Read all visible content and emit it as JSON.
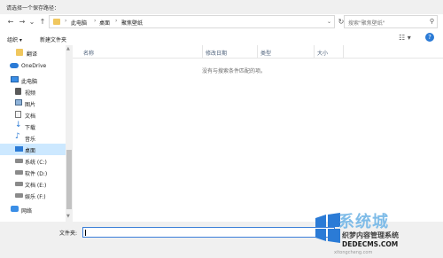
{
  "window": {
    "title": "请选择一个保存路径："
  },
  "nav": {
    "back_icon": "left-arrow-icon",
    "forward_icon": "right-arrow-icon",
    "up_icon": "up-arrow-icon",
    "breadcrumbs": [
      "此电脑",
      "桌面",
      "聚焦壁纸"
    ],
    "search_placeholder": "搜索\"聚焦壁纸\""
  },
  "toolbar": {
    "organize_label": "组织 ▾",
    "new_folder_label": "新建文件夹"
  },
  "sidebar": {
    "items": [
      {
        "label": "翻译",
        "icon": "folder-icon"
      },
      {
        "label": "OneDrive",
        "icon": "cloud-icon"
      },
      {
        "label": "此电脑",
        "icon": "computer-icon"
      },
      {
        "label": "视频",
        "icon": "video-icon"
      },
      {
        "label": "图片",
        "icon": "picture-icon"
      },
      {
        "label": "文档",
        "icon": "document-icon"
      },
      {
        "label": "下载",
        "icon": "download-icon"
      },
      {
        "label": "音乐",
        "icon": "music-icon"
      },
      {
        "label": "桌面",
        "icon": "desktop-icon",
        "selected": true
      },
      {
        "label": "系统 (C:)",
        "icon": "drive-icon"
      },
      {
        "label": "软件 (D:)",
        "icon": "drive-icon"
      },
      {
        "label": "文档 (E:)",
        "icon": "drive-icon"
      },
      {
        "label": "娱乐 (F:)",
        "icon": "drive-icon"
      },
      {
        "label": "网络",
        "icon": "network-icon"
      }
    ]
  },
  "columns": [
    "名称",
    "修改日期",
    "类型",
    "大小"
  ],
  "empty_message": "没有与搜索条件匹配的项。",
  "footer": {
    "filename_label": "文件夹:",
    "filename_value": ""
  },
  "watermark": {
    "big": "系统城",
    "cn": "织梦内容管理系统",
    "url": "DEDECMS.COM",
    "url2": "xitongcheng.com"
  },
  "colors": {
    "accent": "#2b7bd6",
    "selected": "#cce8ff",
    "folder": "#f0c75e"
  }
}
